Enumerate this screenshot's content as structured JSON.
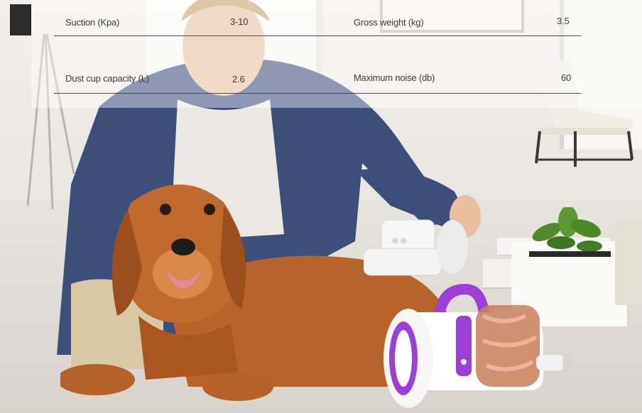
{
  "specs": {
    "rows": [
      {
        "left_label": "Suction (Kpa)",
        "left_value": "3-10",
        "right_label": "Gross weight (kg)",
        "right_value": "3.5"
      },
      {
        "left_label": "Dust cup capacity (L)",
        "left_value": "2.6",
        "right_label": "Maximum noise (db)",
        "right_value": "60"
      }
    ]
  },
  "colors": {
    "accent_purple": "#9b3fd6",
    "panel_text": "#3b3b3b",
    "dog_fur": "#b8632a"
  }
}
